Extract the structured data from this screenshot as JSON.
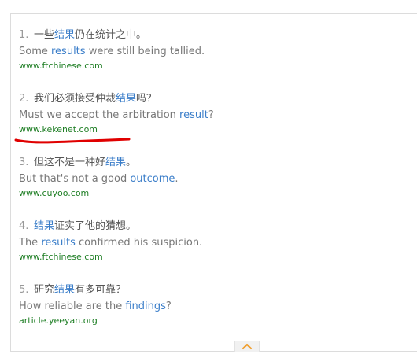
{
  "colors": {
    "highlight": "#3b7ec9",
    "source": "#1e7e24",
    "chinese_text": "#555555",
    "english_text": "#777777",
    "annotation": "#e00000",
    "panel_border": "#dcdcdc"
  },
  "examples": [
    {
      "number": "1.",
      "zh_pre": "一些",
      "zh_term": "结果",
      "zh_post": "仍在统计之中。",
      "en_pre": "Some ",
      "en_term": "results",
      "en_post": " were still being tallied.",
      "source": "www.ftchinese.com"
    },
    {
      "number": "2.",
      "zh_pre": "我们必须接受仲裁",
      "zh_term": "结果",
      "zh_post": "吗？",
      "en_pre": "Must we accept the arbitration ",
      "en_term": "result",
      "en_post": "?",
      "source": "www.kekenet.com"
    },
    {
      "number": "3.",
      "zh_pre": "但这不是一种好",
      "zh_term": "结果",
      "zh_post": "。",
      "en_pre": "But that's not a good ",
      "en_term": "outcome",
      "en_post": ".",
      "source": "www.cuyoo.com"
    },
    {
      "number": "4.",
      "zh_pre": "",
      "zh_term": "结果",
      "zh_post": "证实了他的猜想。",
      "en_pre": "The ",
      "en_term": "results",
      "en_post": " confirmed his suspicion.",
      "source": "www.ftchinese.com"
    },
    {
      "number": "5.",
      "zh_pre": "研究",
      "zh_term": "结果",
      "zh_post": "有多可靠？",
      "en_pre": "How reliable are the ",
      "en_term": "findings",
      "en_post": "?",
      "source": "article.yeeyan.org"
    }
  ],
  "collapse_icon": "chevron-up-icon",
  "annotation_icon": "red-underline-mark"
}
